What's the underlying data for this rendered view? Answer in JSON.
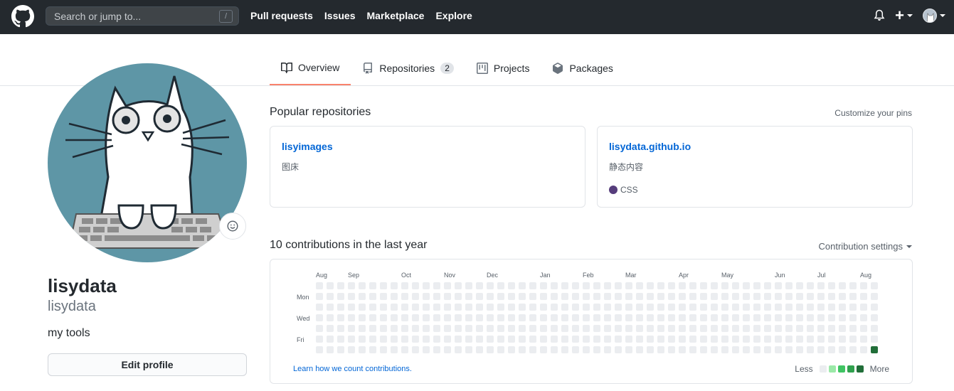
{
  "header": {
    "search_placeholder": "Search or jump to...",
    "slash_key": "/",
    "nav": [
      "Pull requests",
      "Issues",
      "Marketplace",
      "Explore"
    ],
    "plus_glyph": "+",
    "icons": [
      "github-logo-icon",
      "bell-icon",
      "plus-icon",
      "caret-down-icon"
    ]
  },
  "tabs": [
    {
      "label": "Overview",
      "icon": "book-icon",
      "active": true
    },
    {
      "label": "Repositories",
      "icon": "repo-icon",
      "counter": "2"
    },
    {
      "label": "Projects",
      "icon": "project-icon"
    },
    {
      "label": "Packages",
      "icon": "package-icon"
    }
  ],
  "profile": {
    "fullname": "lisydata",
    "username": "lisydata",
    "bio": "my tools",
    "edit_button": "Edit profile"
  },
  "pinned": {
    "title": "Popular repositories",
    "customize": "Customize your pins",
    "repos": [
      {
        "name": "lisyimages",
        "description": "图床",
        "language": ""
      },
      {
        "name": "lisydata.github.io",
        "description": "静态内容",
        "language": "CSS",
        "language_color": "#563d7c"
      }
    ]
  },
  "contributions": {
    "title": "10 contributions in the last year",
    "settings": "Contribution settings",
    "months": [
      "Aug",
      "Sep",
      "Oct",
      "Nov",
      "Dec",
      "Jan",
      "Feb",
      "Mar",
      "Apr",
      "May",
      "Jun",
      "Jul",
      "Aug"
    ],
    "month_start_week": [
      0,
      3,
      8,
      12,
      16,
      21,
      25,
      29,
      34,
      38,
      43,
      47,
      51
    ],
    "days": [
      "Mon",
      "Wed",
      "Fri"
    ],
    "weeks": 53,
    "active_cells": [
      {
        "week": 52,
        "day": 6,
        "level": 4
      }
    ],
    "learn_link": "Learn how we count contributions.",
    "legend_less": "Less",
    "legend_more": "More",
    "colors": [
      "#ebedf0",
      "#9be9a8",
      "#40c463",
      "#30a14e",
      "#216e39"
    ]
  }
}
